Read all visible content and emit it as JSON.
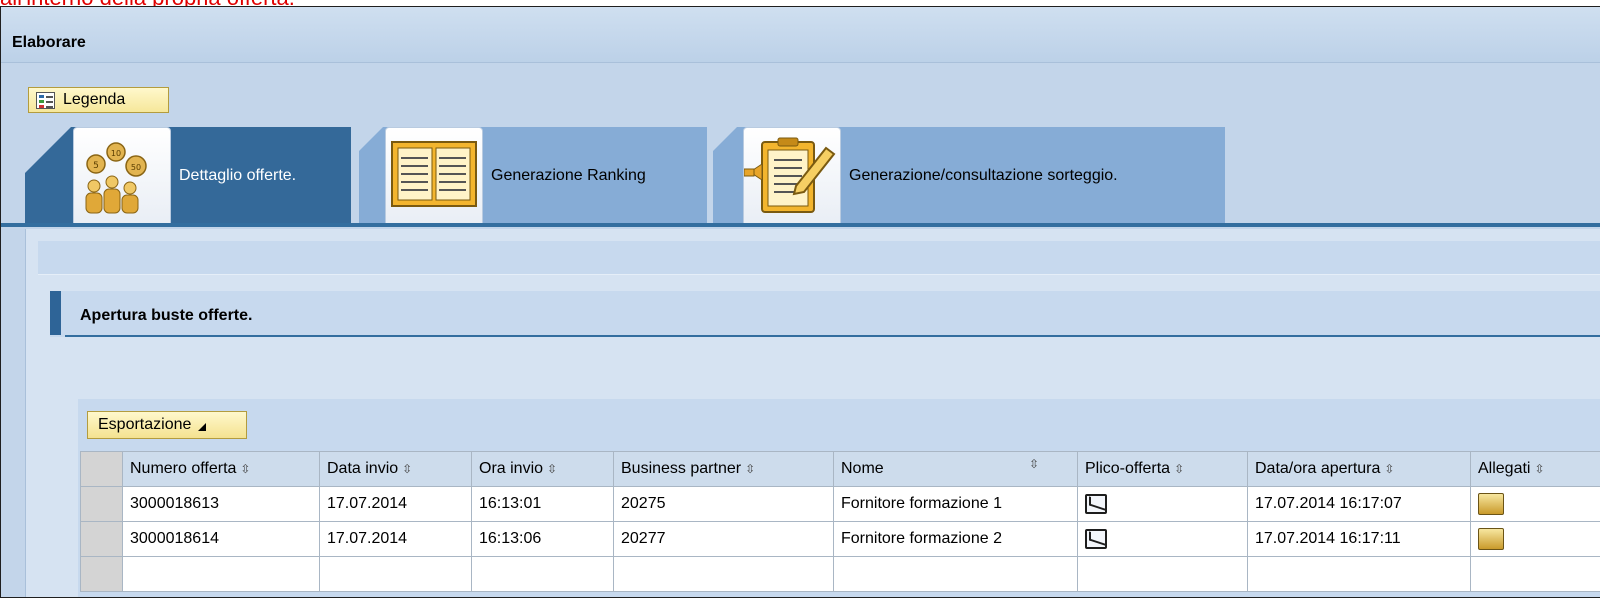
{
  "caption": "all'interno della propria offerta.",
  "window": {
    "title": "Elaborare"
  },
  "legend_button": {
    "label": "Legenda",
    "icon": "legend-icon"
  },
  "tabs": [
    {
      "label": "Dettaglio offerte.",
      "icon": "coins-people-icon",
      "active": true
    },
    {
      "label": "Generazione Ranking",
      "icon": "ranking-table-icon",
      "active": false
    },
    {
      "label": "Generazione/consultazione sorteggio.",
      "icon": "clipboard-pencil-icon",
      "active": false
    }
  ],
  "section": {
    "title": "Apertura buste offerte."
  },
  "export_button": {
    "label": "Esportazione"
  },
  "table": {
    "columns": [
      "Numero offerta",
      "Data invio",
      "Ora invio",
      "Business partner",
      "Nome",
      "Plico-offerta",
      "Data/ora apertura",
      "Allegati"
    ],
    "rows": [
      {
        "numero": "3000018613",
        "data": "17.07.2014",
        "ora": "16:13:01",
        "bp": "20275",
        "nome": "Fornitore formazione 1",
        "plico_icon": "envelope-icon",
        "apertura": "17.07.2014 16:17:07",
        "allegati_icon": "attachment-icon"
      },
      {
        "numero": "3000018614",
        "data": "17.07.2014",
        "ora": "16:13:06",
        "bp": "20277",
        "nome": "Fornitore formazione 2",
        "plico_icon": "envelope-icon",
        "apertura": "17.07.2014 16:17:11",
        "allegati_icon": "attachment-icon"
      }
    ]
  },
  "colors": {
    "active_tab": "#346999",
    "inactive_tab": "#86acd6",
    "accent_line": "#336e9f",
    "caption_red": "#e00000"
  }
}
